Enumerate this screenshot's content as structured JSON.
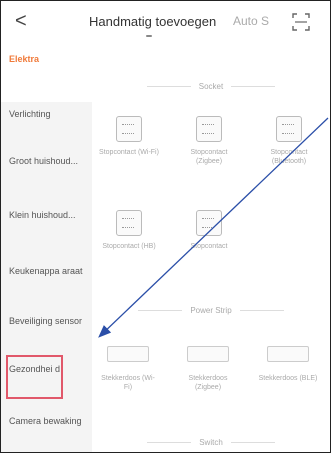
{
  "header": {
    "back_glyph": "<",
    "title": "Handmatig toevoegen",
    "auto_label": "Auto S"
  },
  "sidebar": {
    "items": [
      {
        "label": "Elektra"
      },
      {
        "label": "Verlichting"
      },
      {
        "label": "Groot huishoud..."
      },
      {
        "label": "Klein huishoud..."
      },
      {
        "label": "Keukenappa araat"
      },
      {
        "label": "Beveiliging sensor"
      },
      {
        "label": "Gezondhei d"
      },
      {
        "label": "Camera bewaking"
      }
    ]
  },
  "content": {
    "sections": [
      {
        "title": "Socket"
      },
      {
        "title": "Power Strip"
      },
      {
        "title": "Switch"
      }
    ],
    "sockets": [
      {
        "label": "Stopcontact (Wi-Fi)"
      },
      {
        "label": "Stopcontact (Zigbee)"
      },
      {
        "label": "Stopcontact (Bluetooth)"
      },
      {
        "label": "Stopcontact (HB)"
      },
      {
        "label": "Stopcontact"
      }
    ],
    "power_strips": [
      {
        "label": "Stekkerdoos (Wi-Fi)"
      },
      {
        "label": "Stekkerdoos (Zigbee)"
      },
      {
        "label": "Stekkerdoos (BLE)"
      }
    ]
  },
  "colors": {
    "accent": "#f07a3a",
    "highlight_box": "#e1586a",
    "arrow": "#2b4fa8"
  }
}
